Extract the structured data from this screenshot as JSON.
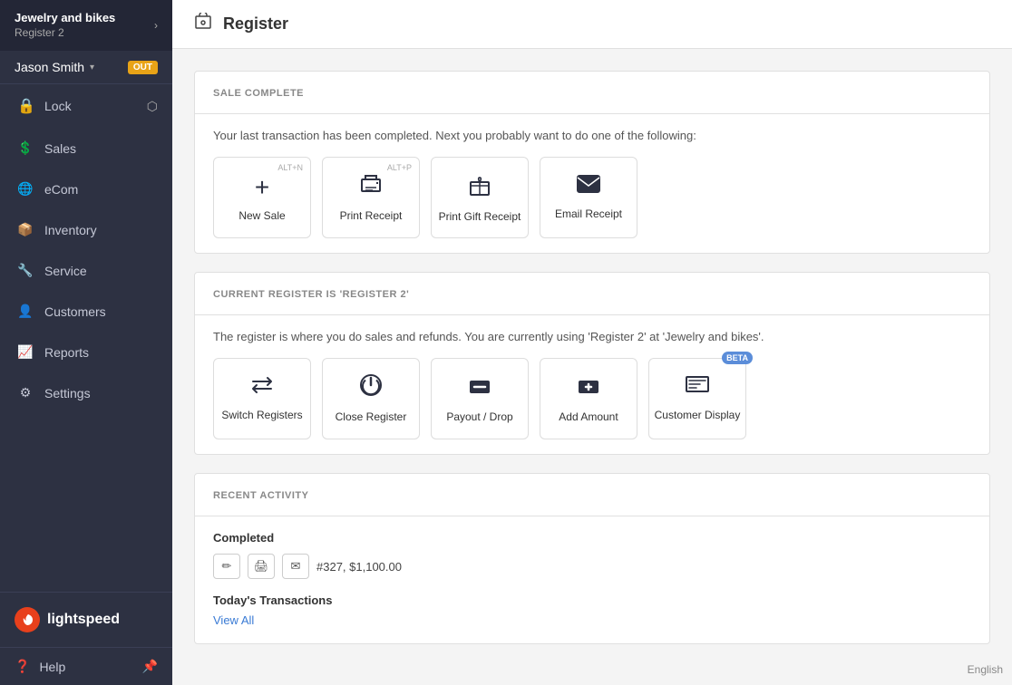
{
  "brand": {
    "name": "Jewelry and bikes",
    "register": "Register 2",
    "arrow": "›"
  },
  "user": {
    "name": "Jason Smith",
    "badge": "OUT",
    "dropdown": "▾"
  },
  "sidebar": {
    "lock_label": "Lock",
    "nav_items": [
      {
        "id": "sales",
        "label": "Sales",
        "icon": "💰"
      },
      {
        "id": "ecom",
        "label": "eCom",
        "icon": "🌐"
      },
      {
        "id": "inventory",
        "label": "Inventory",
        "icon": "📦"
      },
      {
        "id": "service",
        "label": "Service",
        "icon": "🔧"
      },
      {
        "id": "customers",
        "label": "Customers",
        "icon": "👤"
      },
      {
        "id": "reports",
        "label": "Reports",
        "icon": "📈"
      },
      {
        "id": "settings",
        "label": "Settings",
        "icon": "⚙"
      }
    ],
    "logo_text": "lightspeed",
    "help_label": "Help"
  },
  "header": {
    "title": "Register",
    "icon": "👤"
  },
  "sale_complete": {
    "section_title": "SALE COMPLETE",
    "description": "Your last transaction has been completed. Next you probably want to do one of the following:",
    "cards": [
      {
        "id": "new-sale",
        "label": "New Sale",
        "shortcut": "ALT+N",
        "icon": "+"
      },
      {
        "id": "print-receipt",
        "label": "Print Receipt",
        "shortcut": "ALT+P",
        "icon": "🖨"
      },
      {
        "id": "print-gift-receipt",
        "label": "Print Gift Receipt",
        "shortcut": "",
        "icon": "🎁"
      },
      {
        "id": "email-receipt",
        "label": "Email Receipt",
        "shortcut": "",
        "icon": "✉"
      }
    ]
  },
  "register": {
    "section_title": "CURRENT REGISTER IS 'REGISTER 2'",
    "description": "The register is where you do sales and refunds. You are currently using 'Register 2'  at 'Jewelry and bikes'.",
    "cards": [
      {
        "id": "switch-registers",
        "label": "Switch Registers",
        "shortcut": "",
        "icon": "⇄",
        "beta": false
      },
      {
        "id": "close-register",
        "label": "Close Register",
        "shortcut": "",
        "icon": "⏻",
        "beta": false
      },
      {
        "id": "payout-drop",
        "label": "Payout / Drop",
        "shortcut": "",
        "icon": "−",
        "beta": false
      },
      {
        "id": "add-amount",
        "label": "Add Amount",
        "shortcut": "",
        "icon": "+",
        "beta": false
      },
      {
        "id": "customer-display",
        "label": "Customer Display",
        "shortcut": "",
        "icon": "≡",
        "beta": true
      }
    ]
  },
  "recent_activity": {
    "section_title": "RECENT ACTIVITY",
    "completed_label": "Completed",
    "transaction_info": "#327, $1,100.00",
    "today_transactions_label": "Today's Transactions",
    "view_all_label": "View All"
  },
  "footer": {
    "language": "English"
  }
}
